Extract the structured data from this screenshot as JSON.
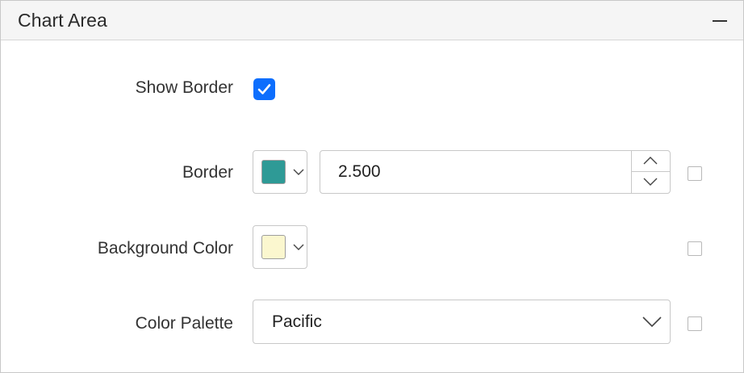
{
  "panel": {
    "title": "Chart Area",
    "collapse_icon": "minus-icon"
  },
  "show_border": {
    "label": "Show Border",
    "checked": true
  },
  "border": {
    "label": "Border",
    "color": "#2e9a96",
    "width_value": "2.500",
    "icons": {
      "up": "chevron-up-icon",
      "down": "chevron-down-icon"
    }
  },
  "background_color": {
    "label": "Background Color",
    "color": "#fbf7cf"
  },
  "color_palette": {
    "label": "Color Palette",
    "selected": "Pacific"
  },
  "colors": {
    "accent": "#0d6efd",
    "header_bg": "#f5f5f5",
    "border": "#c8c8c8"
  }
}
